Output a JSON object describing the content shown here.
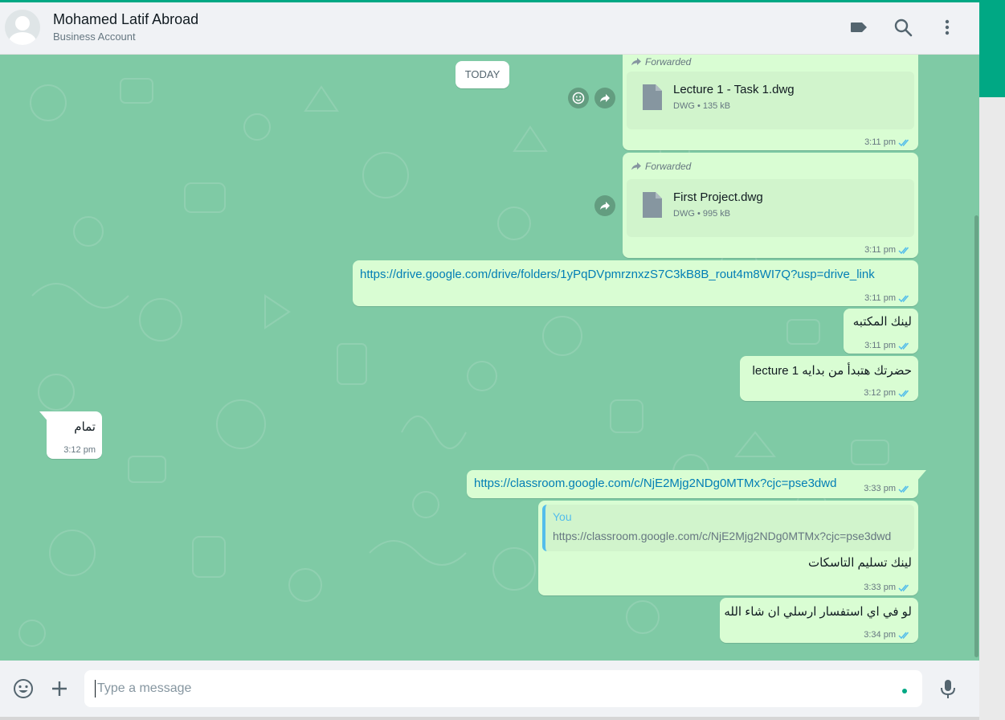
{
  "header": {
    "contact_name": "Mohamed Latif Abroad",
    "contact_subtitle": "Business Account",
    "icons": [
      "label-icon",
      "search-icon",
      "menu-icon"
    ]
  },
  "chat": {
    "date_divider": "TODAY",
    "messages": [
      {
        "type": "document",
        "direction": "outgoing",
        "forwarded_label": "Forwarded",
        "file_name": "Lecture 1 - Task 1.dwg",
        "file_type": "DWG",
        "file_size": "135 kB",
        "time": "3:11 pm",
        "status": "read"
      },
      {
        "type": "document",
        "direction": "outgoing",
        "forwarded_label": "Forwarded",
        "file_name": "First Project.dwg",
        "file_type": "DWG",
        "file_size": "995 kB",
        "time": "3:11 pm",
        "status": "read"
      },
      {
        "type": "link",
        "direction": "outgoing",
        "text": "https://drive.google.com/drive/folders/1yPqDVpmrznxzS7C3kB8B_rout4m8WI7Q?usp=drive_link",
        "time": "3:11 pm",
        "status": "read"
      },
      {
        "type": "text",
        "direction": "outgoing",
        "text": "لينك المكتبه",
        "time": "3:11 pm",
        "status": "read"
      },
      {
        "type": "text",
        "direction": "outgoing",
        "text": "حضرتك هتبدأ من بدايه lecture 1",
        "time": "3:12 pm",
        "status": "read"
      },
      {
        "type": "text",
        "direction": "incoming",
        "text": "تمام",
        "time": "3:12 pm"
      },
      {
        "type": "link",
        "direction": "outgoing",
        "text": "https://classroom.google.com/c/NjE2Mjg2NDg0MTMx?cjc=pse3dwd",
        "time": "3:33 pm",
        "status": "read"
      },
      {
        "type": "reply",
        "direction": "outgoing",
        "quoted_author": "You",
        "quoted_text": "https://classroom.google.com/c/NjE2Mjg2NDg0MTMx?cjc=pse3dwd",
        "text": "لينك تسليم التاسكات",
        "time": "3:33 pm",
        "status": "read"
      },
      {
        "type": "text",
        "direction": "outgoing",
        "text": "لو في اي استفسار ارسلي ان شاء الله",
        "time": "3:34 pm",
        "status": "read"
      }
    ]
  },
  "composer": {
    "placeholder": "Type a message",
    "value": "",
    "icons": [
      "emoji-icon",
      "plus-icon",
      "mic-icon"
    ]
  },
  "colors": {
    "accent": "#00a884",
    "outgoing_bubble": "#d9fdd3",
    "incoming_bubble": "#ffffff",
    "chat_background": "#7fcaa5",
    "link": "#027eb5",
    "read_ticks": "#53bdeb"
  }
}
